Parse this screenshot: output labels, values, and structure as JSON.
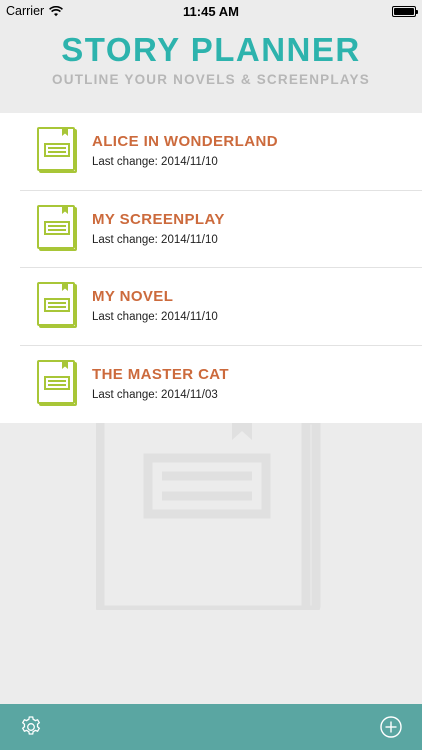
{
  "status_bar": {
    "carrier": "Carrier",
    "time": "11:45 AM",
    "battery_level": 1.0,
    "icons": [
      "wifi-icon",
      "battery-icon"
    ]
  },
  "header": {
    "title": "STORY PLANNER",
    "subtitle": "OUTLINE YOUR NOVELS & SCREENPLAYS"
  },
  "stories": [
    {
      "title": "ALICE IN WONDERLAND",
      "last_change": "Last change: 2014/11/10",
      "icon": "book-icon"
    },
    {
      "title": "MY SCREENPLAY",
      "last_change": "Last change: 2014/11/10",
      "icon": "book-icon"
    },
    {
      "title": "MY NOVEL",
      "last_change": "Last change: 2014/11/10",
      "icon": "book-icon"
    },
    {
      "title": "THE MASTER CAT",
      "last_change": "Last change: 2014/11/03",
      "icon": "book-icon"
    }
  ],
  "bottom_bar": {
    "left_icon": "settings-gear-icon",
    "right_icon": "add-circle-icon"
  },
  "colors": {
    "accent": "#2db3ad",
    "title_orange": "#cc6a3c",
    "icon_green": "#a8c637",
    "bottom_bar": "#5aa6a2",
    "subtitle_gray": "#b7b7b7",
    "background": "#ececec"
  }
}
